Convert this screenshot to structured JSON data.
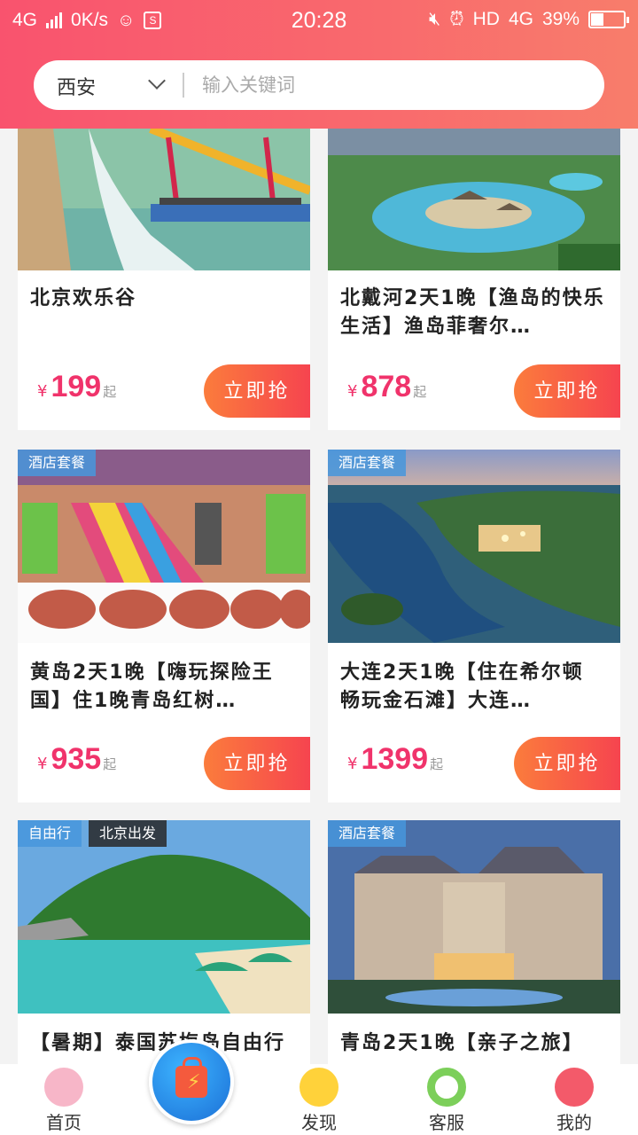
{
  "status_bar": {
    "network": "4G",
    "speed": "0K/s",
    "time": "20:28",
    "hd": "HD",
    "network_right": "4G",
    "battery": "39%",
    "battery_level": 0.39
  },
  "search": {
    "city": "西安",
    "placeholder": "输入关键词"
  },
  "products": [
    {
      "title": "北京欢乐谷",
      "price": "199",
      "currency": "¥",
      "suffix": "起",
      "button": "立即抢",
      "tags": []
    },
    {
      "title": "北戴河2天1晚【渔岛的快乐生活】渔岛菲奢尔…",
      "price": "878",
      "currency": "¥",
      "suffix": "起",
      "button": "立即抢",
      "tags": []
    },
    {
      "title": "黄岛2天1晚【嗨玩探险王国】住1晚青岛红树…",
      "price": "935",
      "currency": "¥",
      "suffix": "起",
      "button": "立即抢",
      "tags": [
        "酒店套餐"
      ]
    },
    {
      "title": "大连2天1晚【住在希尔顿 畅玩金石滩】大连…",
      "price": "1399",
      "currency": "¥",
      "suffix": "起",
      "button": "立即抢",
      "tags": [
        "酒店套餐"
      ]
    },
    {
      "title": "【暑期】泰国苏梅岛自由行",
      "price": "",
      "currency": "",
      "suffix": "",
      "button": "",
      "tags": [
        "自由行",
        "北京出发"
      ]
    },
    {
      "title": "青岛2天1晚【亲子之旅】",
      "price": "",
      "currency": "",
      "suffix": "",
      "button": "",
      "tags": [
        "酒店套餐"
      ]
    }
  ],
  "tabbar": {
    "home": "首页",
    "discover": "发现",
    "service": "客服",
    "mine": "我的"
  }
}
